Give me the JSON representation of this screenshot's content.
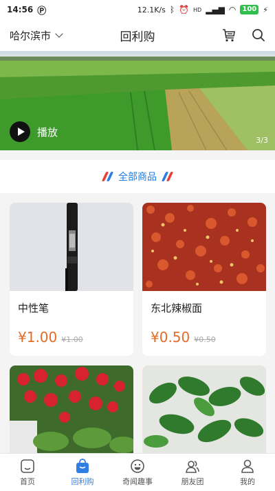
{
  "status_bar": {
    "time": "14:56",
    "network_speed": "12.1K/s",
    "signal_label": "HD",
    "battery": "100"
  },
  "header": {
    "city": "哈尔滨市",
    "title": "回利购"
  },
  "banner": {
    "play_label": "播放",
    "counter": "3/3"
  },
  "section": {
    "title": "全部商品"
  },
  "products": [
    {
      "name": "中性笔",
      "price": "¥1.00",
      "original_price": "¥1.00"
    },
    {
      "name": "东北辣椒面",
      "price": "¥0.50",
      "original_price": "¥0.50"
    }
  ],
  "tabbar": {
    "items": [
      {
        "label": "首页",
        "icon": "home-icon"
      },
      {
        "label": "回利购",
        "icon": "shopping-bag-icon"
      },
      {
        "label": "奇闻趣事",
        "icon": "smiley-icon"
      },
      {
        "label": "朋友团",
        "icon": "friends-icon"
      },
      {
        "label": "我的",
        "icon": "profile-icon"
      }
    ],
    "active_index": 1
  },
  "colors": {
    "accent": "#2f7ee3",
    "price": "#e36b26",
    "section_red": "#e8413a"
  }
}
